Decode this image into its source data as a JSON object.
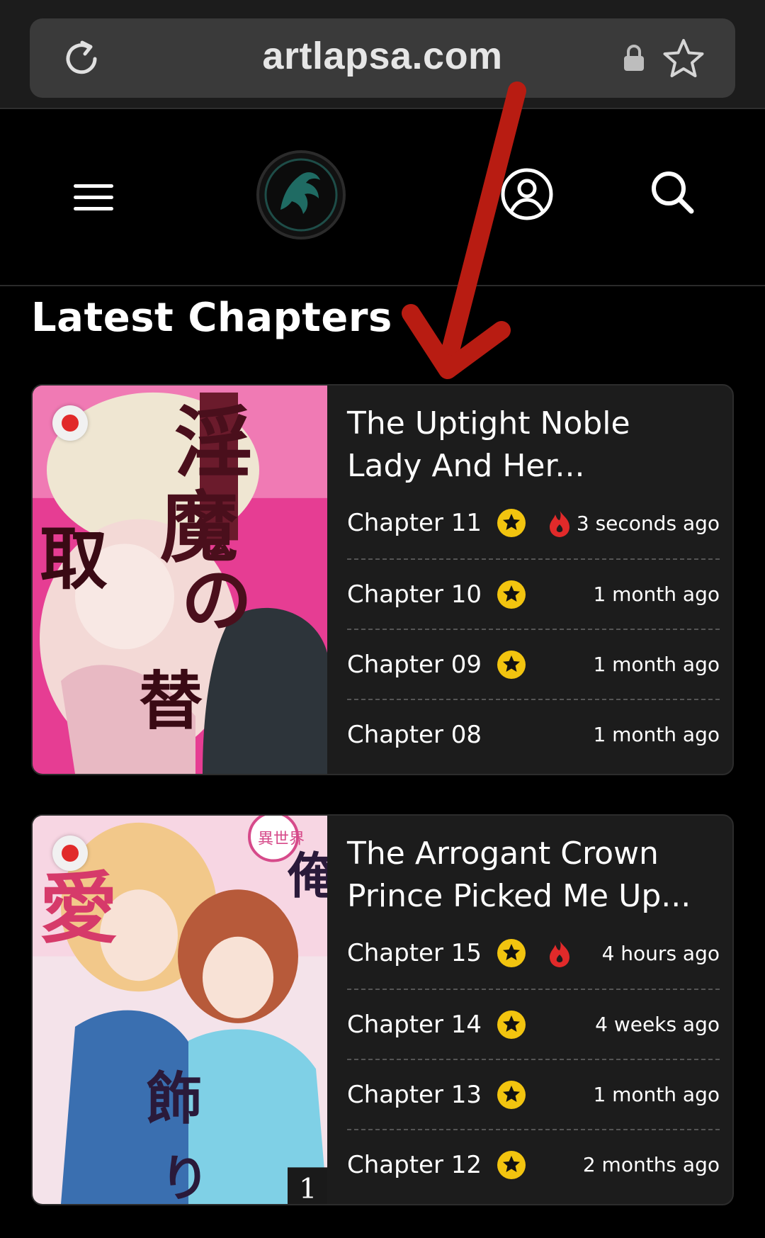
{
  "browser": {
    "url": "artlapsa.com"
  },
  "header": {
    "menu_icon": "hamburger-menu-icon",
    "logo_icon": "site-logo",
    "profile_icon": "user-circle-icon",
    "search_icon": "search-icon"
  },
  "section_title": "Latest Chapters",
  "annotation": {
    "color": "#b81c12"
  },
  "series": [
    {
      "title": "The Uptight Noble\nLady And Her...",
      "chapters": [
        {
          "label": "Chapter 11",
          "time": "3 seconds ago",
          "star": true,
          "hot": true
        },
        {
          "label": "Chapter 10",
          "time": "1 month ago",
          "star": true,
          "hot": false
        },
        {
          "label": "Chapter 09",
          "time": "1 month ago",
          "star": true,
          "hot": false
        },
        {
          "label": "Chapter 08",
          "time": "1 month ago",
          "star": false,
          "hot": false
        }
      ]
    },
    {
      "title": "The Arrogant Crown\nPrince Picked Me Up...",
      "chapters": [
        {
          "label": "Chapter 15",
          "time": "4 hours ago",
          "star": true,
          "hot": true
        },
        {
          "label": "Chapter 14",
          "time": "4 weeks ago",
          "star": true,
          "hot": false
        },
        {
          "label": "Chapter 13",
          "time": "1 month ago",
          "star": true,
          "hot": false
        },
        {
          "label": "Chapter 12",
          "time": "2 months ago",
          "star": true,
          "hot": false
        }
      ]
    }
  ],
  "colors": {
    "star": "#f2c40f",
    "hot": "#e12a2a",
    "background": "#000000",
    "card": "#1c1c1c"
  }
}
